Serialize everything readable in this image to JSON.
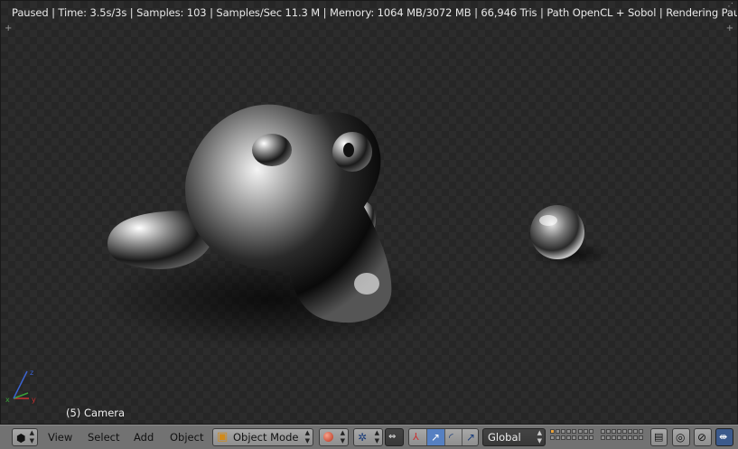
{
  "app": "Blender 3D Viewport",
  "viewport": {
    "status_text": "Paused | Time: 3.5s/3s | Samples: 103 | Samples/Sec 11.3 M | Memory: 1064 MB/3072 MB | 66,946 Tris | Path OpenCL + Sobol | Rendering Paused",
    "object_label": "(5) Camera"
  },
  "header": {
    "menus": {
      "view": "View",
      "select": "Select",
      "add": "Add",
      "object": "Object"
    },
    "mode": {
      "selected": "Object Mode",
      "icon": "cube-icon"
    },
    "viewport_shading": {
      "icon": "sphere-shading-icon"
    },
    "pivot": {
      "icon": "pivot-point-icon"
    },
    "transform_orientation": {
      "selected": "Global"
    },
    "icons": [
      "editor-type-icon",
      "cube-icon",
      "sphere-shading-icon",
      "pivot-point-icon",
      "proportional-edit-icon",
      "translate-manipulator-icon",
      "rotate-manipulator-icon",
      "scale-manipulator-icon",
      "layers-grid-icon",
      "lock-layers-icon",
      "snap-icon",
      "onion-icon",
      "render-icon"
    ]
  },
  "colors": {
    "viewport_bg": "#2c2c2c",
    "checker": "#262626",
    "header_bg": "#727272",
    "active_button": "#5680c2"
  }
}
